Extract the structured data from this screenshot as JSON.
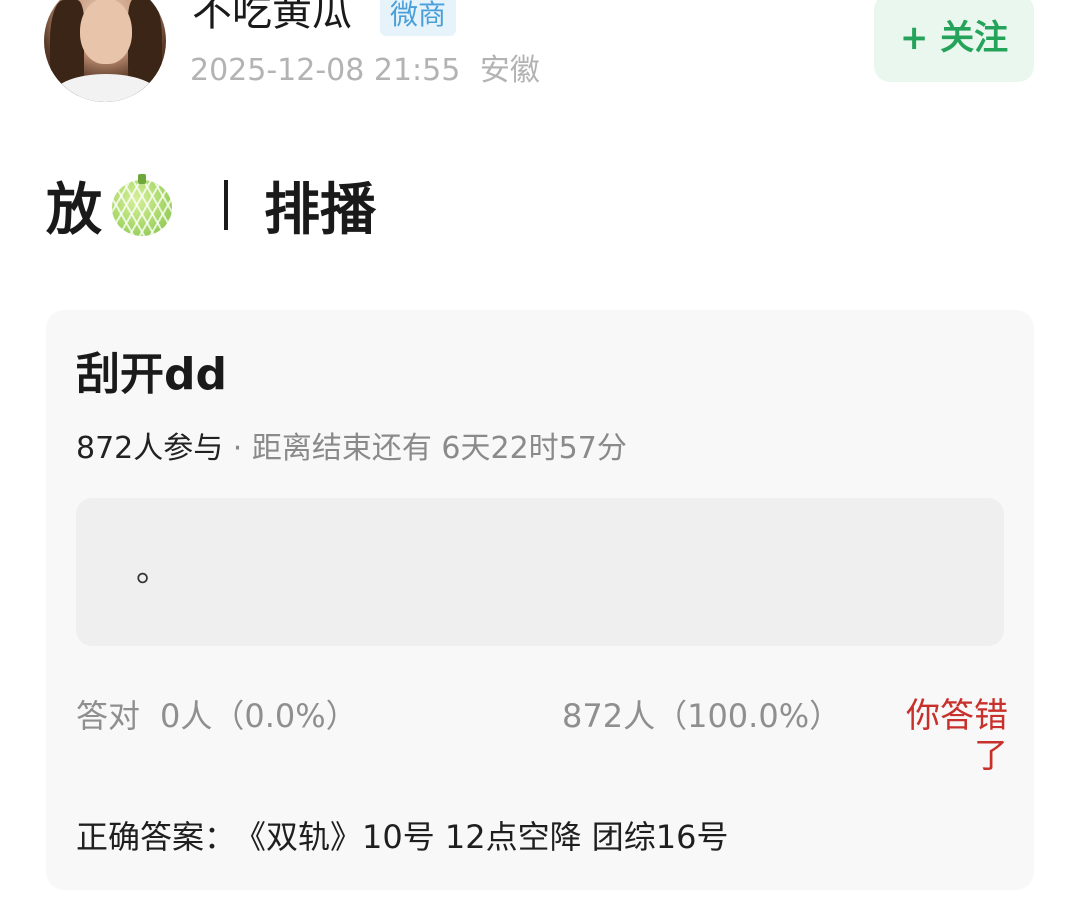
{
  "header": {
    "username": "不吃黄瓜",
    "badge": "微商",
    "timestamp": "2025-12-08 21:55",
    "location": "安徽",
    "follow_label": "+ 关注"
  },
  "post": {
    "title_start": "放",
    "title_icon": "melon-icon",
    "title_end": "排播"
  },
  "quiz": {
    "title": "刮开dd",
    "participants": "872人参与",
    "time_left": " · 距离结束还有 6天22时57分",
    "hidden_answer": "。",
    "correct_label": "答对",
    "correct_value": "0人（0.0%）",
    "wrong_value": "872人（100.0%）",
    "wrong_label": "你答错了",
    "answer_label": "正确答案：",
    "answer_value": "《双轨》10号 12点空降 团综16号"
  },
  "colors": {
    "follow_bg": "#eaf7ee",
    "follow_text": "#25a35a",
    "badge_bg": "#e6f3fb",
    "badge_text": "#4a9fd8",
    "wrong_text": "#c8302b",
    "card_bg": "#f8f8f8"
  }
}
